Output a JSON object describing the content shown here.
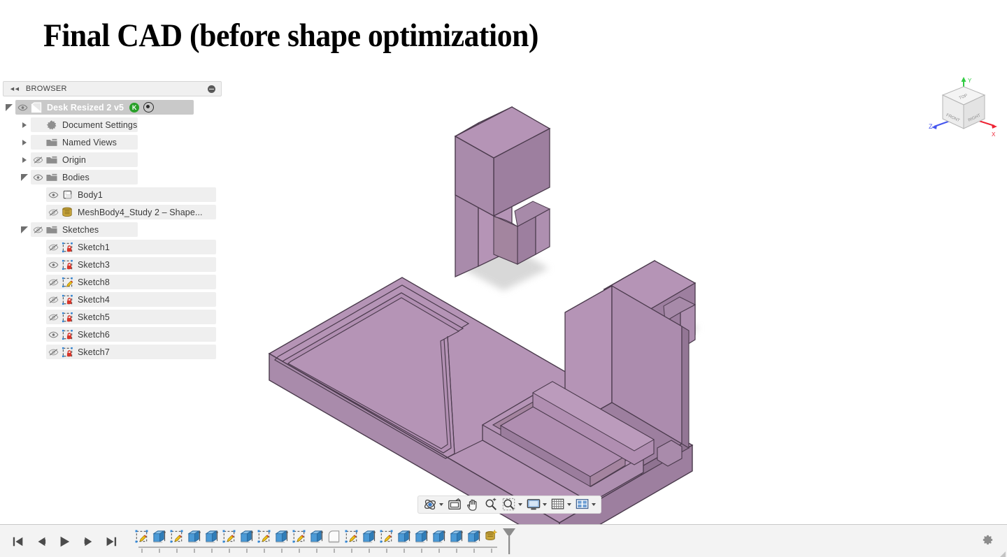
{
  "slide": {
    "title": "Final CAD (before shape optimization)"
  },
  "browser": {
    "panel_title": "BROWSER",
    "collapse_icon": "double-left-arrow-icon",
    "minimize_icon": "minimize-icon",
    "tree": [
      {
        "label": "Desk Resized 2 v5",
        "indent": 0,
        "expander": "open",
        "visible": true,
        "icon": "component-icon",
        "selected": true,
        "badge": "K",
        "has_target": true
      },
      {
        "label": "Document Settings",
        "indent": 1,
        "expander": "closed",
        "visible": null,
        "icon": "gear-icon",
        "selected": false
      },
      {
        "label": "Named Views",
        "indent": 1,
        "expander": "closed",
        "visible": null,
        "icon": "folder-icon",
        "selected": false
      },
      {
        "label": "Origin",
        "indent": 1,
        "expander": "closed",
        "visible": false,
        "icon": "folder-icon",
        "selected": false
      },
      {
        "label": "Bodies",
        "indent": 1,
        "expander": "open",
        "visible": true,
        "icon": "folder-icon",
        "selected": false
      },
      {
        "label": "Body1",
        "indent": 2,
        "expander": "none",
        "visible": true,
        "icon": "body-icon",
        "selected": false
      },
      {
        "label": "MeshBody4_Study 2 – Shape...",
        "indent": 2,
        "expander": "none",
        "visible": false,
        "icon": "mesh-body-icon",
        "selected": false
      },
      {
        "label": "Sketches",
        "indent": 1,
        "expander": "open",
        "visible": false,
        "icon": "folder-icon",
        "selected": false
      },
      {
        "label": "Sketch1",
        "indent": 2,
        "expander": "none",
        "visible": false,
        "icon": "sketch-locked-icon",
        "selected": false
      },
      {
        "label": "Sketch3",
        "indent": 2,
        "expander": "none",
        "visible": true,
        "icon": "sketch-locked-icon",
        "selected": false
      },
      {
        "label": "Sketch8",
        "indent": 2,
        "expander": "none",
        "visible": false,
        "icon": "sketch-edit-icon",
        "selected": false
      },
      {
        "label": "Sketch4",
        "indent": 2,
        "expander": "none",
        "visible": false,
        "icon": "sketch-locked-icon",
        "selected": false
      },
      {
        "label": "Sketch5",
        "indent": 2,
        "expander": "none",
        "visible": false,
        "icon": "sketch-locked-icon",
        "selected": false
      },
      {
        "label": "Sketch6",
        "indent": 2,
        "expander": "none",
        "visible": true,
        "icon": "sketch-locked-icon",
        "selected": false
      },
      {
        "label": "Sketch7",
        "indent": 2,
        "expander": "none",
        "visible": false,
        "icon": "sketch-locked-icon",
        "selected": false
      }
    ]
  },
  "viewcube": {
    "top_face": "TOP",
    "front_face": "FRONT",
    "right_face": "RIGHT",
    "axis_x": "X",
    "axis_y": "Y",
    "axis_z": "Z",
    "axis_x_color": "#ee2233",
    "axis_y_color": "#33cc44",
    "axis_z_color": "#4455ee"
  },
  "nav_toolbar": {
    "buttons": [
      {
        "icon": "orbit-icon",
        "caret": true
      },
      {
        "icon": "look-at-icon",
        "caret": false
      },
      {
        "icon": "pan-hand-icon",
        "caret": false
      },
      {
        "icon": "zoom-icon",
        "caret": false
      },
      {
        "icon": "zoom-window-icon",
        "caret": true
      },
      {
        "icon": "display-settings-icon",
        "caret": true
      },
      {
        "icon": "grid-snaps-icon",
        "caret": true
      },
      {
        "icon": "viewports-icon",
        "caret": true
      }
    ]
  },
  "timeline": {
    "playback": [
      {
        "icon": "skip-to-beginning-icon"
      },
      {
        "icon": "step-back-icon"
      },
      {
        "icon": "play-icon"
      },
      {
        "icon": "step-forward-icon"
      },
      {
        "icon": "skip-to-end-icon"
      }
    ],
    "features": [
      {
        "type": "sketch"
      },
      {
        "type": "extrude"
      },
      {
        "type": "sketch"
      },
      {
        "type": "extrude"
      },
      {
        "type": "extrude"
      },
      {
        "type": "sketch"
      },
      {
        "type": "extrude"
      },
      {
        "type": "sketch"
      },
      {
        "type": "extrude"
      },
      {
        "type": "sketch"
      },
      {
        "type": "extrude"
      },
      {
        "type": "fillet"
      },
      {
        "type": "sketch"
      },
      {
        "type": "extrude"
      },
      {
        "type": "sketch"
      },
      {
        "type": "extrude"
      },
      {
        "type": "extrude"
      },
      {
        "type": "extrude"
      },
      {
        "type": "extrude"
      },
      {
        "type": "extrude"
      },
      {
        "type": "shape-optimization"
      }
    ],
    "end_marker": "timeline-end-marker",
    "settings_icon": "gear-icon"
  },
  "model": {
    "name": "desk-organizer-3d-model",
    "face_top": "#b594b6",
    "face_left": "#a98bab",
    "face_right": "#9d7f9f",
    "edge": "#4a3a4c",
    "shadow": "#d4d4d4"
  }
}
